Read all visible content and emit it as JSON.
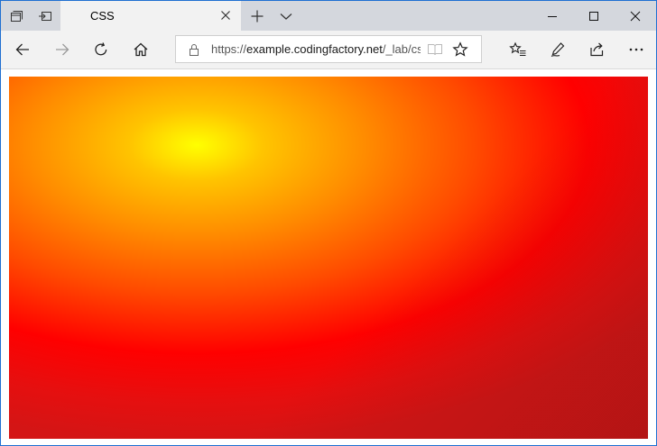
{
  "window": {
    "tab": {
      "title": "CSS"
    }
  },
  "navbar": {
    "address": {
      "url_scheme": "https://",
      "url_host": "example.codingfactory.net",
      "url_path": "/_lab/cs"
    }
  },
  "page": {
    "gradient": {
      "colors": [
        "#ffff00",
        "#ff8c00",
        "#ff0000",
        "#d41515"
      ]
    }
  },
  "icons": {
    "tab_actions": "tab-actions-icon",
    "set_aside": "set-aside-tabs-icon",
    "tab_close": "close-icon",
    "new_tab": "plus-icon",
    "tab_list": "chevron-down-icon",
    "minimize": "minimize-icon",
    "maximize": "maximize-icon",
    "close_window": "close-icon",
    "back": "arrow-left-icon",
    "forward": "arrow-right-icon",
    "refresh": "refresh-icon",
    "home": "home-icon",
    "lock": "lock-icon",
    "reading_view": "book-icon",
    "favorite": "star-icon",
    "favorites_hub": "favorites-list-icon",
    "notes": "pen-icon",
    "share": "share-icon",
    "more": "ellipsis-icon"
  }
}
